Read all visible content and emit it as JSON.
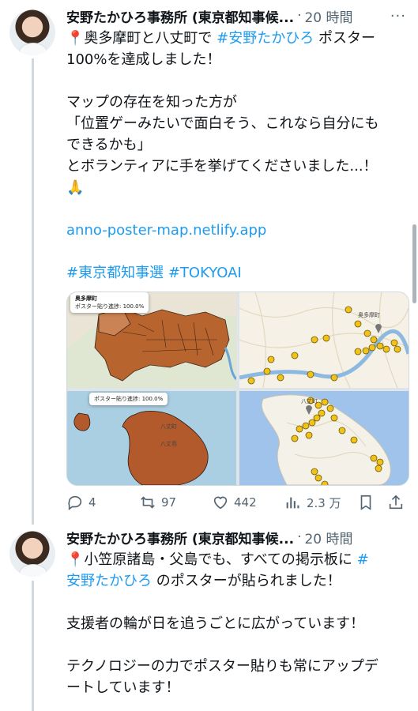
{
  "tweet1": {
    "author": "安野たかひろ事務所 (東京都知事候...",
    "separator": "·",
    "time": "20 時間",
    "more_icon": "more-dots-icon",
    "line1_pin": "📍",
    "line1_a": "奥多摩町と八丈町で ",
    "line1_tag": "#安野たかひろ",
    "line1_b": " ポスター",
    "line2": "100%を達成しました！",
    "line3": "マップの存在を知った方が",
    "line4": "「位置ゲーみたいで面白そう、これなら自分にも",
    "line5": "できるかも」",
    "line6": "とボランティアに手を挙げてくださいました...！",
    "line7": "🙏",
    "link": "anno-poster-map.netlify.app",
    "tag1": "#東京都知事選",
    "tag2": "#TOKYOAI",
    "map1_popup_title": "奥多摩町",
    "map1_popup_text": "ポスター貼り進捗: 100.0%",
    "map3_popup_text": "ポスター貼り進捗: 100.0%",
    "map3_label_a": "八丈町",
    "map3_label_b": "八丈島",
    "map2_label": "奥多摩町",
    "map4_label": "八丈町",
    "replies": "4",
    "retweets": "97",
    "likes": "442",
    "views": "2.3 万"
  },
  "tweet2": {
    "author": "安野たかひろ事務所 (東京都知事候...",
    "separator": "·",
    "time": "20 時間",
    "line1_pin": "📍",
    "line1_a": "小笠原諸島・父島でも、すべての掲示板に ",
    "line1_tag_a": "#",
    "line2_tag": "安野たかひろ",
    "line2_b": " のポスターが貼られました！",
    "line3": "支援者の輪が日を追うごとに広がっています！",
    "line4": "テクノロジーの力でポスター貼りも常にアップデ",
    "line5": "ートしています！"
  },
  "colors": {
    "link": "#1d9bf0",
    "muted": "#536471",
    "map_fill": "#b25a2c",
    "pin": "#f2c21b"
  }
}
